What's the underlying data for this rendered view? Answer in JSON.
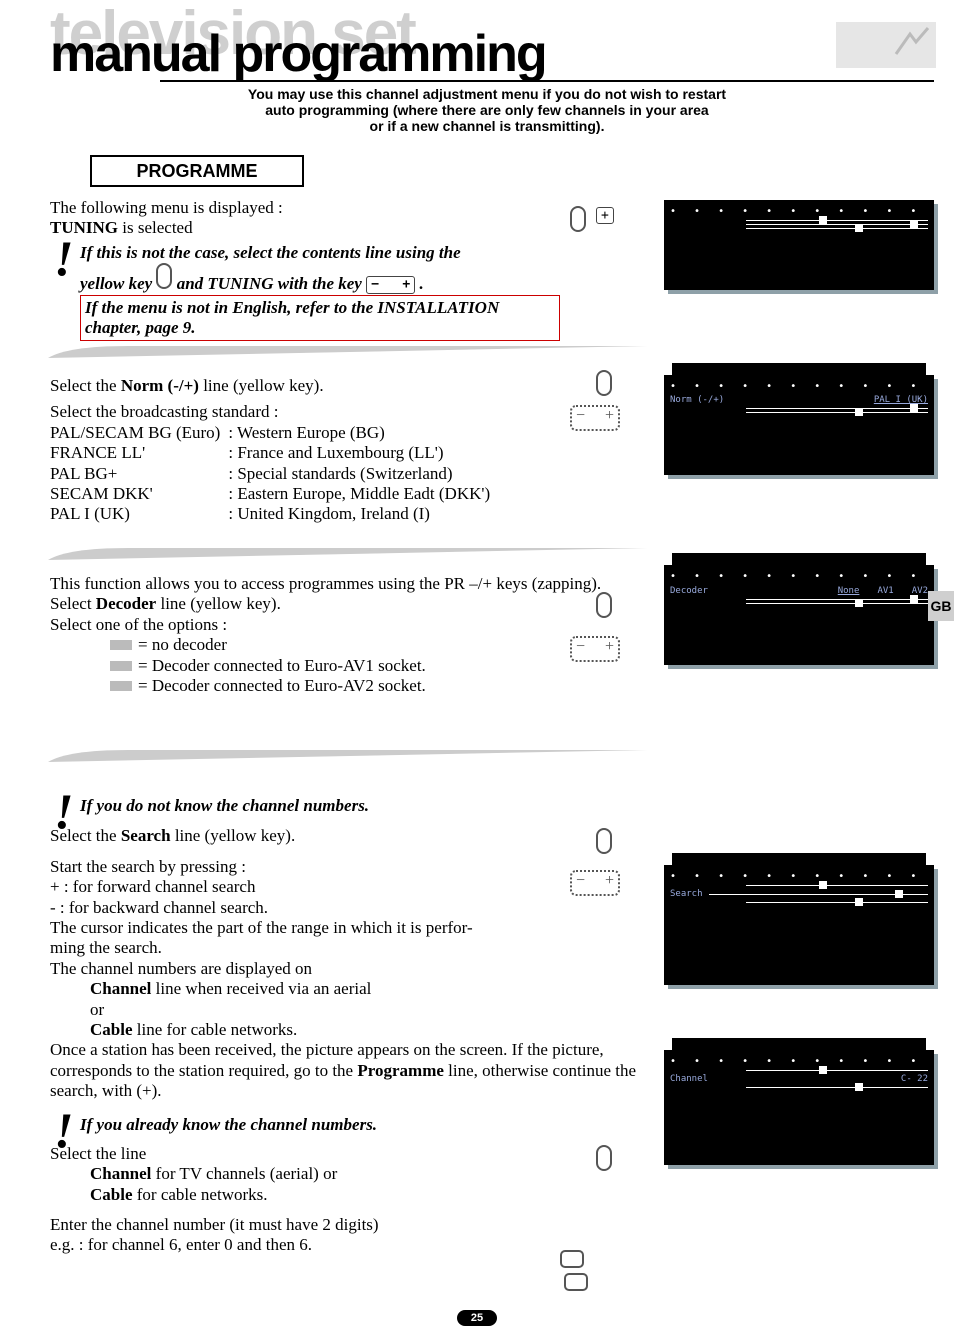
{
  "header": {
    "ghost_title": "television set",
    "title": "manual programming",
    "subtitle_l1": "You may use this channel adjustment menu if you do not wish to restart",
    "subtitle_l2": "auto programming (where there are only few channels in your area",
    "subtitle_l3": "or if a new channel is transmitting)."
  },
  "prog_label": "PROGRAMME",
  "section1": {
    "line1": "The following menu is displayed :",
    "line2_pre": "TUNING",
    "line2_post": " is selected",
    "emph1_a": "If this is not the case, select the contents line using the",
    "emph1_b_pre": "yellow key ",
    "emph1_b_mid": " and TUNING with the key ",
    "emph1_b_end": " .",
    "emph2": "If the menu is not in English, refer to the INSTALLATION chapter, page 9."
  },
  "section2": {
    "line1_a": "Select the  ",
    "line1_b": "Norm (-/+)",
    "line1_c": " line (yellow key).",
    "line2": "Select the broadcasting standard :",
    "standards": [
      {
        "code": "PAL/SECAM BG (Euro)",
        "desc": ": Western Europe (BG)"
      },
      {
        "code": "FRANCE LL'",
        "desc": ": France and Luxembourg (LL')"
      },
      {
        "code": "PAL BG+",
        "desc": ": Special standards (Switzerland)"
      },
      {
        "code": "SECAM DKK'",
        "desc": ": Eastern Europe, Middle Eadt (DKK')"
      },
      {
        "code": "PAL I (UK)",
        "desc": ": United Kingdom, Ireland (I)"
      }
    ]
  },
  "section3": {
    "line1": "This function allows you to access programmes using the PR –/+ keys (zapping).",
    "line2_a": "Select ",
    "line2_b": "Decoder",
    "line2_c": " line (yellow key).",
    "line3": "Select one of the options :",
    "options": [
      "= no decoder",
      "= Decoder connected to Euro-AV1 socket.",
      "= Decoder connected to Euro-AV2 socket."
    ]
  },
  "section4": {
    "note_unknown": "If you do not know the channel numbers.",
    "l1_a": "Select the ",
    "l1_b": "Search",
    "l1_c": " line (yellow key).",
    "l2": "Start the search by pressing :",
    "l3": " + : for forward channel search",
    "l4": " - : for backward channel search.",
    "l5": "The cursor indicates the part of the range in which it is perfor-",
    "l5b": "ming the search.",
    "l6": "The channel numbers are displayed on",
    "l7_a": "Channel",
    "l7_b": " line when received via an aerial",
    "l7_c": "or",
    "l8_a": "Cable",
    "l8_b": " line for cable networks.",
    "l9_a": "Once a station has been received, the picture appears on the screen. If the picture, corresponds to the station required, go to the ",
    "l9_b": "Programme",
    "l9_c": " line, otherwise continue the search, with (+).",
    "note_known": "If you already know the channel numbers.",
    "k1": "Select the line",
    "k2_a": "Channel",
    "k2_b": " for TV channels (aerial) or",
    "k3_a": "Cable",
    "k3_b": " for cable networks.",
    "k4": "Enter the channel number (it must have 2 digits)",
    "k5": "e.g. : for channel 6, enter 0 and then 6."
  },
  "diagrams": {
    "d2_l": "Norm (-/+)",
    "d2_r": "PAL I (UK)",
    "d3_l": "Decoder",
    "d3_r1": "None",
    "d3_r2": "AV1",
    "d3_r3": "AV2",
    "d4_l": "Search",
    "d5_l": "Channel",
    "d5_r": "C- 22"
  },
  "side_tab": "GB",
  "page_num": "25"
}
